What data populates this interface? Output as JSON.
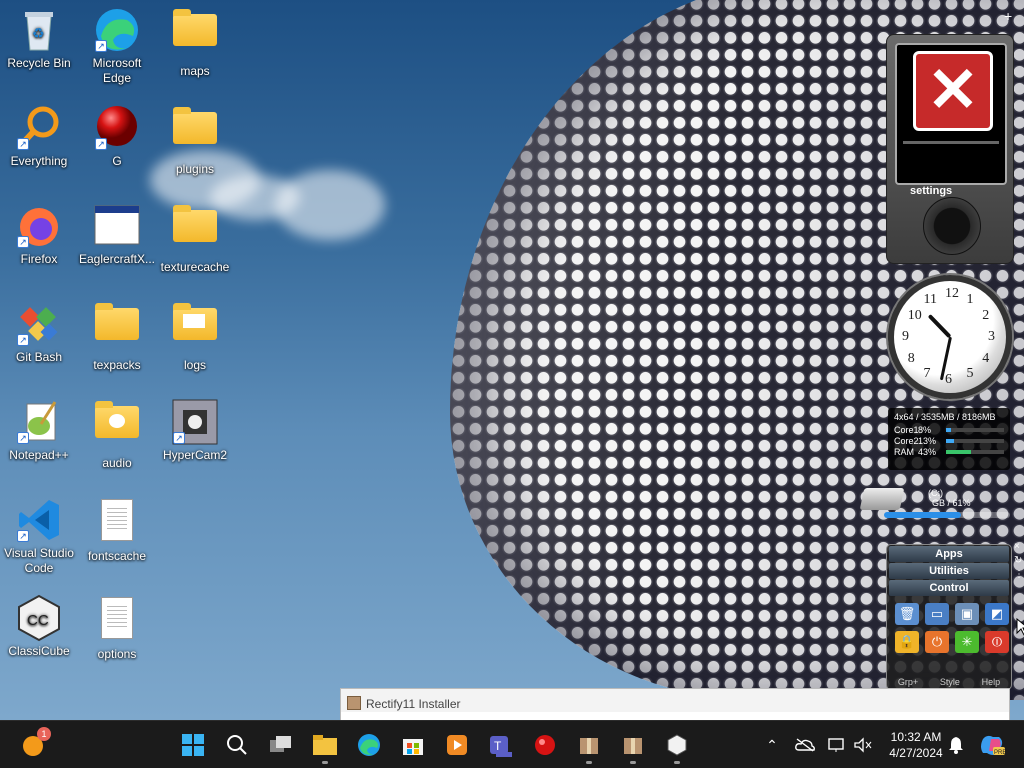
{
  "desktop": {
    "icons": [
      {
        "name": "recycle-bin",
        "label": "Recycle Bin"
      },
      {
        "name": "microsoft-edge",
        "label": "Microsoft Edge"
      },
      {
        "name": "maps",
        "label": "maps"
      },
      {
        "name": "everything",
        "label": "Everything"
      },
      {
        "name": "g",
        "label": "G"
      },
      {
        "name": "plugins",
        "label": "plugins"
      },
      {
        "name": "firefox",
        "label": "Firefox"
      },
      {
        "name": "eaglercraftx",
        "label": "EaglercraftX..."
      },
      {
        "name": "texturecache",
        "label": "texturecache"
      },
      {
        "name": "git-bash",
        "label": "Git Bash"
      },
      {
        "name": "texpacks",
        "label": "texpacks"
      },
      {
        "name": "logs",
        "label": "logs"
      },
      {
        "name": "notepad-plus-plus",
        "label": "Notepad++"
      },
      {
        "name": "audio",
        "label": "audio"
      },
      {
        "name": "hypercam2",
        "label": "HyperCam2"
      },
      {
        "name": "visual-studio-code",
        "label": "Visual Studio Code"
      },
      {
        "name": "fontscache",
        "label": "fontscache"
      },
      {
        "name": "classicube",
        "label": "ClassiCube"
      },
      {
        "name": "options",
        "label": "options"
      }
    ]
  },
  "gadgets": {
    "zune": {
      "settings_label": "settings"
    },
    "clock": {
      "numerals": [
        "12",
        "1",
        "2",
        "3",
        "4",
        "5",
        "6",
        "7",
        "8",
        "9",
        "10",
        "11"
      ],
      "hour": 10,
      "minute": 32
    },
    "sysmon": {
      "header": "4x64 / 3535MB / 8186MB",
      "rows": [
        {
          "label": "Core1",
          "pct": "8%",
          "value": 0.08
        },
        {
          "label": "Core2",
          "pct": "13%",
          "value": 0.13
        },
        {
          "label": "RAM",
          "pct": "43%",
          "value": 0.43
        }
      ]
    },
    "drive": {
      "label": "(C:)",
      "stat": "GB / 61%",
      "value": 0.61
    },
    "launcher": {
      "tabs": [
        "Apps",
        "Utilities",
        "Control"
      ],
      "footer": [
        "Grp+",
        "Style",
        "Help"
      ]
    }
  },
  "installer": {
    "title": "Rectify11 Installer"
  },
  "taskbar": {
    "notification_count": "1",
    "date": "4/27/2024",
    "time": "10:32 AM"
  },
  "colors": {
    "taskbar": "#1b1b1b",
    "accent": "#0078d4"
  }
}
